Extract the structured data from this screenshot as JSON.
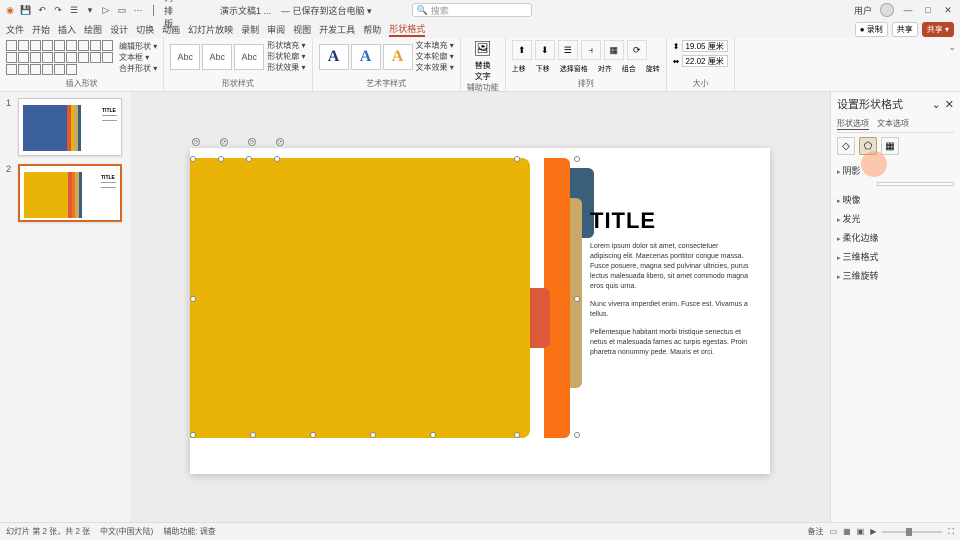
{
  "titlebar": {
    "doc_name": "演示文稿1 ...",
    "save_status": "— 已保存到这台电脑 ▾",
    "search_placeholder": "搜索",
    "user_initial": "用户",
    "window": {
      "min": "—",
      "max": "□",
      "close": "✕"
    }
  },
  "qat_icons": [
    "save-icon",
    "undo-icon",
    "redo-icon",
    "touch-icon",
    "more-icon",
    "slideshow-icon",
    "separator",
    "layout-icon"
  ],
  "menu_tabs": [
    "文件",
    "开始",
    "插入",
    "绘图",
    "设计",
    "切换",
    "动画",
    "幻灯片放映",
    "录制",
    "审阅",
    "视图",
    "开发工具",
    "帮助",
    "形状格式"
  ],
  "menu_active_index": 13,
  "menu_right": {
    "record": "● 录制",
    "present": "共享",
    "share": "共享 ▾"
  },
  "ribbon": {
    "g_shapes": {
      "label": "插入形状",
      "edit_shape": "编辑形状 ▾",
      "text_box": "文本框 ▾",
      "merge": "合并形状 ▾"
    },
    "g_styles": {
      "label": "形状样式",
      "items": [
        "Abc",
        "Abc",
        "Abc"
      ],
      "fill": "形状填充 ▾",
      "outline": "形状轮廓 ▾",
      "effects": "形状效果 ▾"
    },
    "g_wordart": {
      "label": "艺术字样式",
      "fill": "文本填充 ▾",
      "outline": "文本轮廓 ▾",
      "effects": "文本效果 ▾"
    },
    "g_alt": {
      "label": "辅助功能",
      "alt_text": "替换\n文字"
    },
    "g_arrange": {
      "label": "排列",
      "items": [
        "上移",
        "下移",
        "选择窗格",
        "对齐",
        "组合",
        "旋转"
      ]
    },
    "g_size": {
      "label": "大小",
      "height_icon": "⬍",
      "width_icon": "⬌",
      "height": "19.05 厘米",
      "width": "22.02 厘米"
    }
  },
  "thumbnails": [
    "1",
    "2"
  ],
  "slide": {
    "title": "TITLE",
    "p1": "Lorem ipsum dolor sit amet, consectetuer adipiscing elit. Maecenas porttitor congue massa. Fusce posuere, magna sed pulvinar ultricies, purus lectus malesuada libero, sit amet commodo magna eros quis urna.",
    "p2": "Nunc viverra imperdiet enim. Fusce est. Vivamus a tellus.",
    "p3": "Pellentesque habitant morbi tristique senectus et netus et malesuada fames ac turpis egestas. Proin pharetra nonummy pede. Mauris et orci.",
    "colors": {
      "yellow": "#eab308",
      "orange": "#f97316",
      "red": "#dc5a3a",
      "tan": "#c9a968",
      "navy": "#3a5f7a"
    }
  },
  "format_pane": {
    "title": "设置形状格式",
    "close": "✕",
    "chevron": "⌄",
    "tab1": "形状选项",
    "tab2": "文本选项",
    "icons": [
      "◇",
      "⬠",
      "▦"
    ],
    "sections": [
      "阴影",
      "映像",
      "发光",
      "柔化边缘",
      "三维格式",
      "三维旋转"
    ]
  },
  "statusbar": {
    "slide_info": "幻灯片 第 2 张，共 2 张",
    "lang": "中文(中国大陆)",
    "access": "辅助功能: 调查",
    "notes": "备注",
    "views": [
      "normal",
      "sorter",
      "reading",
      "slideshow"
    ],
    "zoom": "- ——·—— +",
    "fit": "⛶"
  }
}
